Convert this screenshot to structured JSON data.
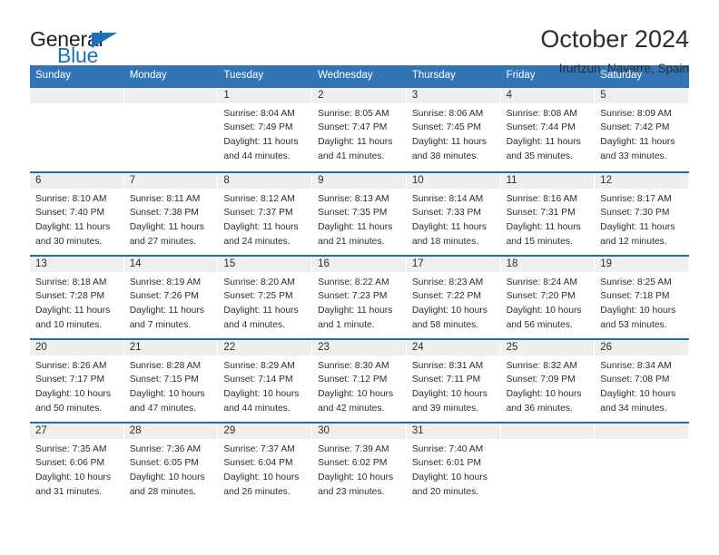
{
  "logo": {
    "word1": "General",
    "word2": "Blue",
    "triangle": "triangle-icon"
  },
  "header": {
    "title": "October 2024",
    "subtitle": "Irurtzun, Navarre, Spain"
  },
  "colors": {
    "header_blue": "#3274b4",
    "row_border_blue": "#1f6cb0",
    "day_strip_gray": "#efefef",
    "logo_blue": "#1b72b8",
    "text": "#2c2c2c"
  },
  "weekdays": [
    "Sunday",
    "Monday",
    "Tuesday",
    "Wednesday",
    "Thursday",
    "Friday",
    "Saturday"
  ],
  "weeks": [
    [
      {
        "day": "",
        "lines": []
      },
      {
        "day": "",
        "lines": []
      },
      {
        "day": "1",
        "lines": [
          "Sunrise: 8:04 AM",
          "Sunset: 7:49 PM",
          "Daylight: 11 hours",
          "and 44 minutes."
        ]
      },
      {
        "day": "2",
        "lines": [
          "Sunrise: 8:05 AM",
          "Sunset: 7:47 PM",
          "Daylight: 11 hours",
          "and 41 minutes."
        ]
      },
      {
        "day": "3",
        "lines": [
          "Sunrise: 8:06 AM",
          "Sunset: 7:45 PM",
          "Daylight: 11 hours",
          "and 38 minutes."
        ]
      },
      {
        "day": "4",
        "lines": [
          "Sunrise: 8:08 AM",
          "Sunset: 7:44 PM",
          "Daylight: 11 hours",
          "and 35 minutes."
        ]
      },
      {
        "day": "5",
        "lines": [
          "Sunrise: 8:09 AM",
          "Sunset: 7:42 PM",
          "Daylight: 11 hours",
          "and 33 minutes."
        ]
      }
    ],
    [
      {
        "day": "6",
        "lines": [
          "Sunrise: 8:10 AM",
          "Sunset: 7:40 PM",
          "Daylight: 11 hours",
          "and 30 minutes."
        ]
      },
      {
        "day": "7",
        "lines": [
          "Sunrise: 8:11 AM",
          "Sunset: 7:38 PM",
          "Daylight: 11 hours",
          "and 27 minutes."
        ]
      },
      {
        "day": "8",
        "lines": [
          "Sunrise: 8:12 AM",
          "Sunset: 7:37 PM",
          "Daylight: 11 hours",
          "and 24 minutes."
        ]
      },
      {
        "day": "9",
        "lines": [
          "Sunrise: 8:13 AM",
          "Sunset: 7:35 PM",
          "Daylight: 11 hours",
          "and 21 minutes."
        ]
      },
      {
        "day": "10",
        "lines": [
          "Sunrise: 8:14 AM",
          "Sunset: 7:33 PM",
          "Daylight: 11 hours",
          "and 18 minutes."
        ]
      },
      {
        "day": "11",
        "lines": [
          "Sunrise: 8:16 AM",
          "Sunset: 7:31 PM",
          "Daylight: 11 hours",
          "and 15 minutes."
        ]
      },
      {
        "day": "12",
        "lines": [
          "Sunrise: 8:17 AM",
          "Sunset: 7:30 PM",
          "Daylight: 11 hours",
          "and 12 minutes."
        ]
      }
    ],
    [
      {
        "day": "13",
        "lines": [
          "Sunrise: 8:18 AM",
          "Sunset: 7:28 PM",
          "Daylight: 11 hours",
          "and 10 minutes."
        ]
      },
      {
        "day": "14",
        "lines": [
          "Sunrise: 8:19 AM",
          "Sunset: 7:26 PM",
          "Daylight: 11 hours",
          "and 7 minutes."
        ]
      },
      {
        "day": "15",
        "lines": [
          "Sunrise: 8:20 AM",
          "Sunset: 7:25 PM",
          "Daylight: 11 hours",
          "and 4 minutes."
        ]
      },
      {
        "day": "16",
        "lines": [
          "Sunrise: 8:22 AM",
          "Sunset: 7:23 PM",
          "Daylight: 11 hours",
          "and 1 minute."
        ]
      },
      {
        "day": "17",
        "lines": [
          "Sunrise: 8:23 AM",
          "Sunset: 7:22 PM",
          "Daylight: 10 hours",
          "and 58 minutes."
        ]
      },
      {
        "day": "18",
        "lines": [
          "Sunrise: 8:24 AM",
          "Sunset: 7:20 PM",
          "Daylight: 10 hours",
          "and 56 minutes."
        ]
      },
      {
        "day": "19",
        "lines": [
          "Sunrise: 8:25 AM",
          "Sunset: 7:18 PM",
          "Daylight: 10 hours",
          "and 53 minutes."
        ]
      }
    ],
    [
      {
        "day": "20",
        "lines": [
          "Sunrise: 8:26 AM",
          "Sunset: 7:17 PM",
          "Daylight: 10 hours",
          "and 50 minutes."
        ]
      },
      {
        "day": "21",
        "lines": [
          "Sunrise: 8:28 AM",
          "Sunset: 7:15 PM",
          "Daylight: 10 hours",
          "and 47 minutes."
        ]
      },
      {
        "day": "22",
        "lines": [
          "Sunrise: 8:29 AM",
          "Sunset: 7:14 PM",
          "Daylight: 10 hours",
          "and 44 minutes."
        ]
      },
      {
        "day": "23",
        "lines": [
          "Sunrise: 8:30 AM",
          "Sunset: 7:12 PM",
          "Daylight: 10 hours",
          "and 42 minutes."
        ]
      },
      {
        "day": "24",
        "lines": [
          "Sunrise: 8:31 AM",
          "Sunset: 7:11 PM",
          "Daylight: 10 hours",
          "and 39 minutes."
        ]
      },
      {
        "day": "25",
        "lines": [
          "Sunrise: 8:32 AM",
          "Sunset: 7:09 PM",
          "Daylight: 10 hours",
          "and 36 minutes."
        ]
      },
      {
        "day": "26",
        "lines": [
          "Sunrise: 8:34 AM",
          "Sunset: 7:08 PM",
          "Daylight: 10 hours",
          "and 34 minutes."
        ]
      }
    ],
    [
      {
        "day": "27",
        "lines": [
          "Sunrise: 7:35 AM",
          "Sunset: 6:06 PM",
          "Daylight: 10 hours",
          "and 31 minutes."
        ]
      },
      {
        "day": "28",
        "lines": [
          "Sunrise: 7:36 AM",
          "Sunset: 6:05 PM",
          "Daylight: 10 hours",
          "and 28 minutes."
        ]
      },
      {
        "day": "29",
        "lines": [
          "Sunrise: 7:37 AM",
          "Sunset: 6:04 PM",
          "Daylight: 10 hours",
          "and 26 minutes."
        ]
      },
      {
        "day": "30",
        "lines": [
          "Sunrise: 7:39 AM",
          "Sunset: 6:02 PM",
          "Daylight: 10 hours",
          "and 23 minutes."
        ]
      },
      {
        "day": "31",
        "lines": [
          "Sunrise: 7:40 AM",
          "Sunset: 6:01 PM",
          "Daylight: 10 hours",
          "and 20 minutes."
        ]
      },
      {
        "day": "",
        "lines": []
      },
      {
        "day": "",
        "lines": []
      }
    ]
  ]
}
